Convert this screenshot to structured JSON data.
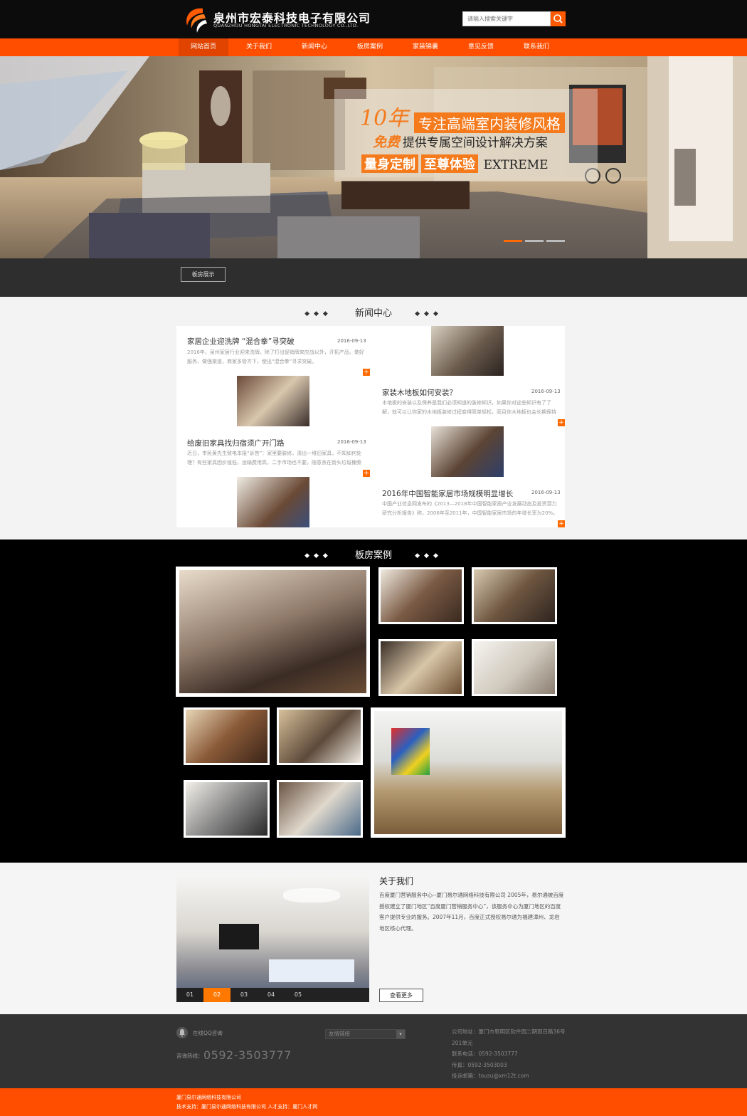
{
  "header": {
    "company_cn": "泉州市宏泰科技电子有限公司",
    "company_en": "QUANZHOU HONGTAI ELECTRONIC TECHNOLOGY CO.,LTD.",
    "search_placeholder": "请输入搜索关键字"
  },
  "nav": [
    "网站首页",
    "关于我们",
    "新闻中心",
    "板房案例",
    "家装锦囊",
    "意见反馈",
    "联系我们"
  ],
  "hero": {
    "line1_num": "10年",
    "line1_text": "专注高端室内装修风格",
    "line2_bold": "免费",
    "line2_text": "提供专属空间设计解决方案",
    "line3_a": "量身定制",
    "line3_b": "至尊体验",
    "line3_en": "EXTREME",
    "button": "板房展示"
  },
  "news": {
    "title": "新闻中心",
    "items": [
      {
        "title": "家居企业迎洗牌 “混合拳”寻突破",
        "date": "2016-09-13",
        "body": "2016年，泉州家居行业迎来洗牌。除了打出促销牌来应战以外，开拓产品、做好服务、做强渠道，商家多管齐下，使出“混合拳”寻求突破。"
      },
      {
        "title": "家装木地板如何安装？",
        "date": "2016-09-13",
        "body": "木地板的安装以及保养是我们必须知道的装修知识，如果你对这些知识有了了解，就可以让你家的木地板装修过程变得简单轻松，而且你木地板也会长期保持光泽，使用"
      },
      {
        "title": "给废旧家具找归宿须广开门路",
        "date": "2016-09-13",
        "body": "近日，市民黄先生致电本报“诉苦”：家里要装修，清出一堆旧家具，不知如何处理？有些家具因价值低，运输费用高，二手市场也不要，随意丢在街头垃圾桶旁又不"
      },
      {
        "title": "2016年中国智能家居市场规模明显增长",
        "date": "2016-09-13",
        "body": "中国产业信息网发布的《2013—2018年中国智能家居产业发展动态及投资潜力研究分析报告》称，2006年至2011年，中国智能家居市场的年增长率为20%，预计2012年"
      }
    ],
    "plus": "+"
  },
  "cases": {
    "title": "板房案例"
  },
  "about": {
    "title": "关于我们",
    "body": "百度厦门营销服务中心--厦门易尔通网络科技有限公司 2005年，易尔通被百度授权建立了厦门地区“百度厦门营销服务中心”，该服务中心为厦门地区的百度客户提供专业的服务。2007年11月，百度正式授权易尔通为福建漳州、龙岩地区核心代理。",
    "more": "查看更多",
    "tabs": [
      "01",
      "02",
      "03",
      "04",
      "05"
    ]
  },
  "footer": {
    "qq": "在线QQ咨询",
    "hotline_label": "咨询热线：",
    "hotline": "0592-3503777",
    "links_select": "友情链接",
    "address": "公司地址：厦门市思明区软件园二期观日路36号201单元",
    "phone": "联系电话：0592-3503777",
    "fax": "传真：0592-3503003",
    "email": "投诉邮箱：tousu@xm12t.com"
  },
  "copyright": {
    "line1": "厦门易尔通网络科技有限公司",
    "line2": "技术支持：厦门易尔通网络科技有限公司 人才支持：厦门人才网"
  },
  "colors": {
    "accent": "#ff4e00",
    "dark": "#0c0c0c",
    "footer": "#333333"
  }
}
